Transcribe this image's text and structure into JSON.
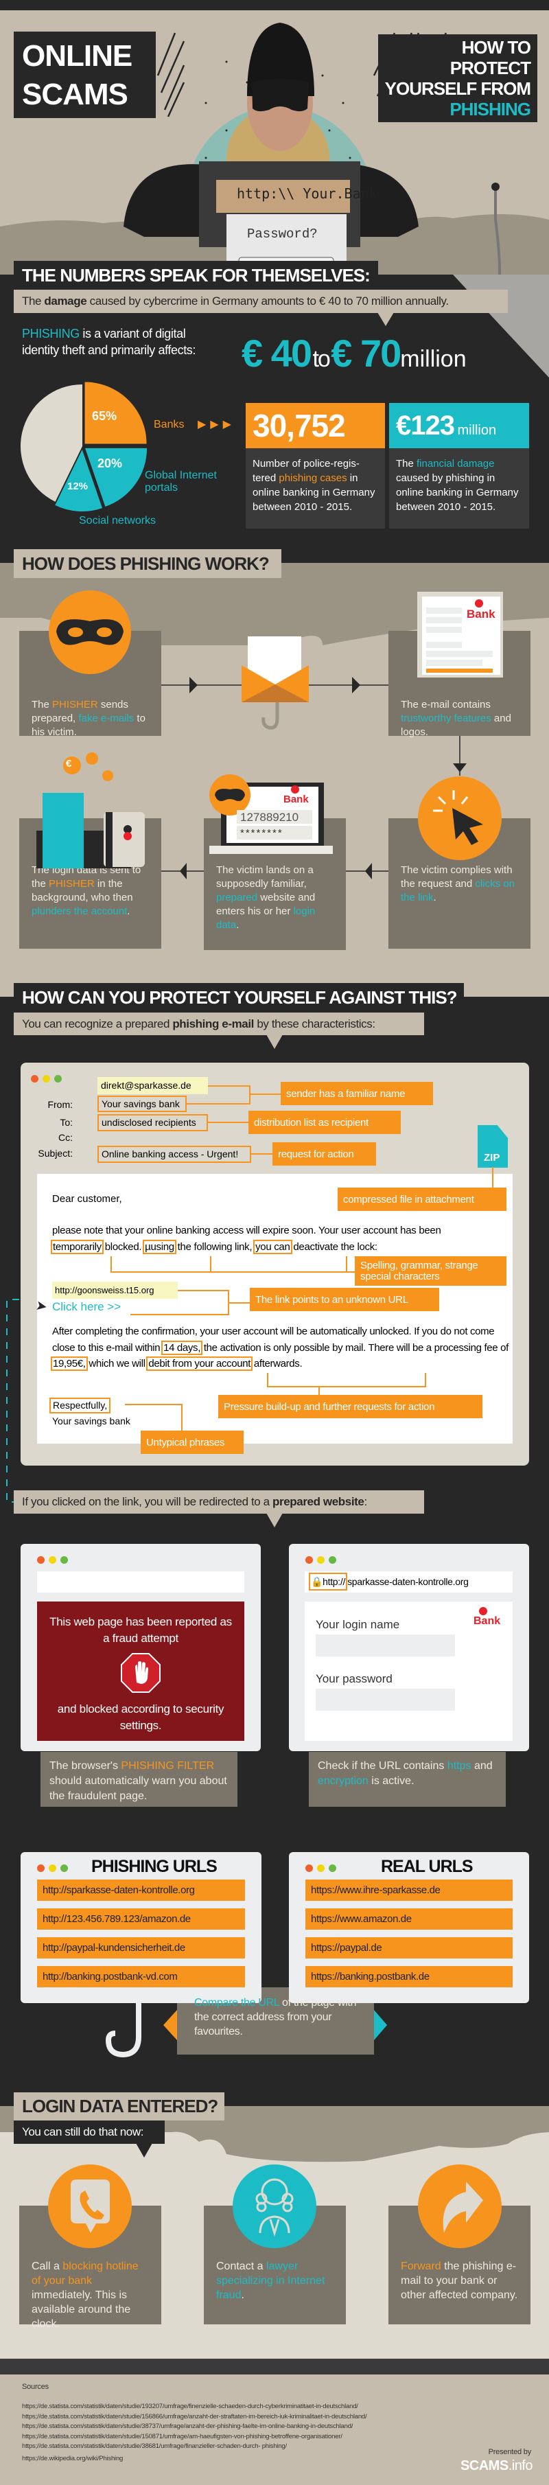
{
  "colors": {
    "teal": "#1cbcc6",
    "orange": "#f7941d",
    "dark": "#272727",
    "beige": "#c5bcad",
    "card": "#7b7569"
  },
  "header": {
    "title_line1": "ONLINE",
    "title_line2": "SCAMS",
    "subtitle_lines": [
      "HOW TO",
      "PROTECT",
      "YOURSELF FROM"
    ],
    "subtitle_accent": "PHISHING",
    "sign_text": "http:\\\\ Your.Bank",
    "screen_prompt": "Password?"
  },
  "numbers": {
    "heading": "THE NUMBERS SPEAK FOR THEMSELVES:",
    "subtitle": [
      {
        "t": "The "
      },
      {
        "t": "damage",
        "c": "b"
      },
      {
        "t": " caused by cybercrime in Germany amounts to € 40 to 70 million annually."
      }
    ],
    "intro": [
      {
        "t": "PHISHING",
        "c": "teal"
      },
      {
        "t": " is a variant of digital identity theft and primarily affects:"
      }
    ],
    "big_from": "€ 40",
    "big_to": "to",
    "big_upper": "€ 70",
    "big_unit": "million",
    "stat1": {
      "value": "30,752",
      "desc": [
        {
          "t": "Number of police-regis­tered "
        },
        {
          "t": "phishing cases",
          "c": "orange"
        },
        {
          "t": " in online banking in Germany between 2010 - 2015."
        }
      ]
    },
    "stat2": {
      "value": "€123",
      "unit": "million",
      "desc": [
        {
          "t": "The "
        },
        {
          "t": "financial damage",
          "c": "teal"
        },
        {
          "t": " caused by phishing in online banking in Germany between 2010 - 2015."
        }
      ]
    }
  },
  "chart_data": {
    "type": "pie",
    "categories": [
      "Banks",
      "Global Internet portals",
      "Social networks"
    ],
    "values": [
      65,
      20,
      12
    ],
    "labels": [
      "65%",
      "20%",
      "12%"
    ],
    "colors": [
      "#f7941d",
      "#1cbcc6",
      "#1cbcc6"
    ]
  },
  "how": {
    "heading": "HOW DOES PHISHING WORK?",
    "steps": [
      {
        "text": [
          {
            "t": "The "
          },
          {
            "t": "PHISHER",
            "c": "orange"
          },
          {
            "t": " sends prepared, "
          },
          {
            "t": "fake e-mails",
            "c": "teal"
          },
          {
            "t": " to his victim."
          }
        ]
      },
      {
        "text": [
          {
            "t": "The e-mail contains "
          },
          {
            "t": "trustworthy features",
            "c": "teal"
          },
          {
            "t": " and logos."
          }
        ]
      },
      {
        "text": [
          {
            "t": "The victim complies with the request and "
          },
          {
            "t": "clicks on the link",
            "c": "teal"
          },
          {
            "t": "."
          }
        ]
      },
      {
        "text": [
          {
            "t": "The victim lands on a supposedly familiar, "
          },
          {
            "t": "prepared",
            "c": "teal"
          },
          {
            "t": " website and enters his or her "
          },
          {
            "t": "login data",
            "c": "teal"
          },
          {
            "t": "."
          }
        ]
      },
      {
        "text": [
          {
            "t": "The login data is sent to the "
          },
          {
            "t": "PHISHER",
            "c": "orange"
          },
          {
            "t": " in the background, who then "
          },
          {
            "t": "plunders the account",
            "c": "teal"
          },
          {
            "t": "."
          }
        ]
      }
    ],
    "bank_logo": "Bank",
    "account_number": "127889210",
    "password_mask": "********",
    "euro": "€"
  },
  "protect": {
    "heading": "HOW CAN YOU PROTECT YOURSELF AGAINST THIS?",
    "subtitle": [
      {
        "t": "You can recognize a prepared "
      },
      {
        "t": "phishing e-mail",
        "c": "b"
      },
      {
        "t": " by these characteristics:"
      }
    ],
    "email": {
      "sender_address": "direkt@sparkasse.de",
      "from_label": "From:",
      "from_value": "Your savings bank",
      "to_label": "To:",
      "to_value": "undisclosed recipients",
      "cc_label": "Cc:",
      "subject_label": "Subject:",
      "subject_value": "Online banking access - Urgent!",
      "attachment": "ZIP",
      "greeting": "Dear customer,",
      "para1": [
        {
          "t": "please note that your online banking access will expire soon. Your user account has been "
        },
        {
          "t": "temporarily",
          "c": "box"
        },
        {
          "t": " blocked. "
        },
        {
          "t": "µusing",
          "c": "box"
        },
        {
          "t": " the following link, "
        },
        {
          "t": "you can",
          "c": "box"
        },
        {
          "t": " deactivate the lock:"
        }
      ],
      "url": "http://goonsweiss.t15.org",
      "link": "Click here >>",
      "para2": [
        {
          "t": "After completing the confirmation, your user account will be automatically unlocked. If you do not come close to this e-mail within "
        },
        {
          "t": "14 days,",
          "c": "box"
        },
        {
          "t": " the activation is only possible by mail. There will be a processing fee of "
        },
        {
          "t": "19,95€,",
          "c": "box"
        },
        {
          "t": " which we will "
        },
        {
          "t": "debit from your account",
          "c": "box"
        },
        {
          "t": " afterwards."
        }
      ],
      "closing": "Respectfully,",
      "signature": "Your savings bank"
    },
    "callouts": {
      "sender": "sender has a familiar name",
      "distribution": "distribution list as recipient",
      "request": "request for action",
      "attachment": "compressed file in attachment",
      "spelling": "Spelling, grammar, strange special characters",
      "link": "The link points to an unknown URL",
      "pressure": "Pressure build-up and further requests for action",
      "phrases": "Untypical phrases"
    },
    "redirect": [
      {
        "t": "If you clicked on the link, you will be redirected to a "
      },
      {
        "t": "prepared website",
        "c": "b"
      },
      {
        "t": ":"
      }
    ],
    "warning": {
      "line1": "This web page has been reported as a fraud attempt",
      "line2": "and blocked according to security settings."
    },
    "fake_site": {
      "url_prefix": "http://",
      "url_rest": "sparkasse-daten-kontrolle.org",
      "bank_logo": "Bank",
      "login_label": "Your login name",
      "password_label": "Your password"
    },
    "tip_filter": [
      {
        "t": "The browser's "
      },
      {
        "t": "PHISHING FILTER",
        "c": "orange"
      },
      {
        "t": " should automatically warn you about the fraudulent page."
      }
    ],
    "tip_https": [
      {
        "t": "Check if the URL contains "
      },
      {
        "t": "https",
        "c": "teal"
      },
      {
        "t": " and "
      },
      {
        "t": "encryption",
        "c": "teal"
      },
      {
        "t": " is active."
      }
    ],
    "phishing_urls": {
      "title": "PHISHING URLS",
      "items": [
        "http://sparkasse-daten-kontrolle.org",
        "http://123.456.789.123/amazon.de",
        "http://paypal-kundensicherheit.de",
        "http://banking.postbank-vd.com"
      ]
    },
    "real_urls": {
      "title": "REAL URLS",
      "items": [
        "https://www.ihre-sparkasse.de",
        "https://www.amazon.de",
        "https://paypal.de",
        "https://banking.postbank.de"
      ]
    },
    "compare": [
      {
        "t": "Compare the URL",
        "c": "teal"
      },
      {
        "t": " of the page with the correct address from your favourites."
      }
    ]
  },
  "login": {
    "heading": "LOGIN DATA ENTERED?",
    "subtitle": "You can still do that now:",
    "actions": [
      {
        "icon": "phone-icon",
        "text": [
          {
            "t": "Call a "
          },
          {
            "t": "blocking hotline of your bank",
            "c": "orange"
          },
          {
            "t": " immediately. This is available around the clock."
          }
        ]
      },
      {
        "icon": "lawyer-icon",
        "text": [
          {
            "t": "Contact a "
          },
          {
            "t": "lawyer specializing in Internet fraud",
            "c": "teal"
          },
          {
            "t": "."
          }
        ]
      },
      {
        "icon": "forward-icon",
        "text": [
          {
            "t": "Forward",
            "c": "orange"
          },
          {
            "t": " the phishing e-mail to your bank or other affected company."
          }
        ]
      }
    ]
  },
  "footer": {
    "sources_label": "Sources",
    "sources": [
      "https;//de.statista.com/statistik/daten/studie/193207/umfrage/finenzielle-schaeden-durch-cyberkriminatitaet-in-deutschland/",
      "https;//de.statista.com/statistik/daten/studie/156866/umfrage/anzaht-der-straftaten-im-bereich-iuk-kriminalitaet-in-deutschland/",
      "https;//de.statista.com/statistik/daten/studie/38737/umfrage/anzaht-der-phishing-faelte-im-online-banking-in-deutschland/",
      "https;//de.statista.com/statistik/daten/studie/150871/umfrage/am-haeufigsten-von-phishing-betroffene-organisationer/",
      "https;//de.statista.com/statistik/daten/studie/38681/umfrage/finanzieller-schaden-durch- phishing/"
    ],
    "wiki": "https;//de.wikipedia.org/wiki/Phishing",
    "presented_by": "Presented by",
    "brand": "SCAMS",
    "brand_suffix": ".info"
  }
}
